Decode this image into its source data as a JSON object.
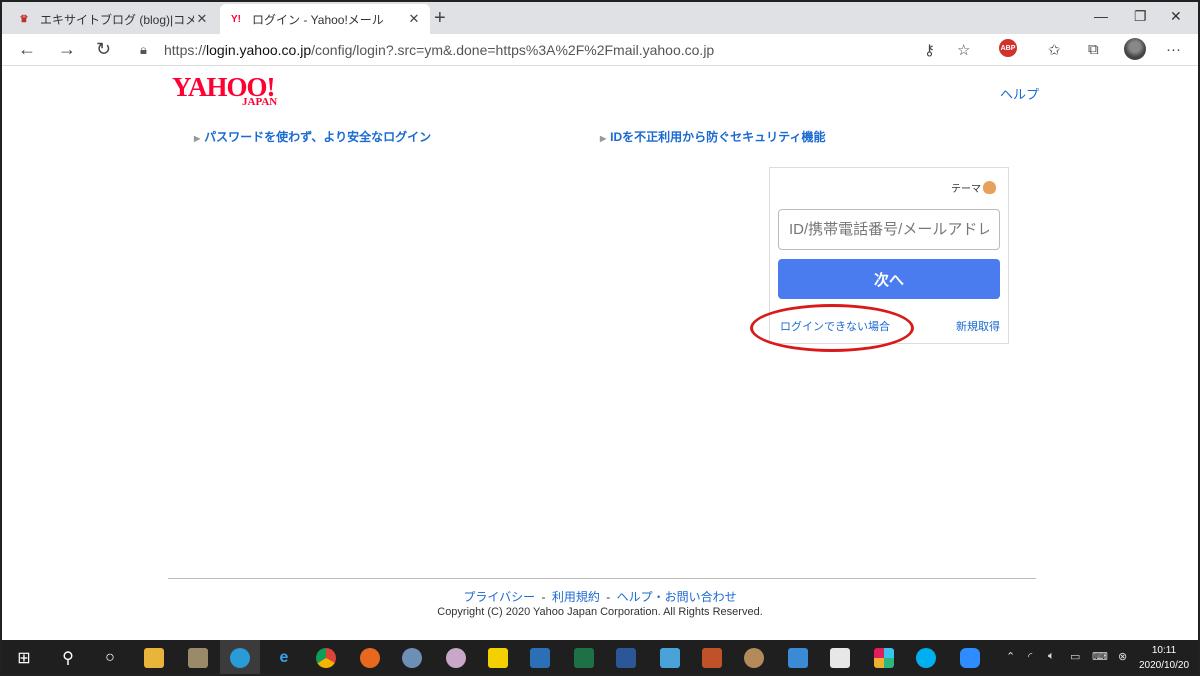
{
  "browser": {
    "tabs": [
      {
        "title": "エキサイトブログ (blog)|コメント・トラ",
        "favicon": "excite-icon"
      },
      {
        "title": "ログイン - Yahoo!メール",
        "favicon": "yahoo-icon",
        "favicon_text": "Y!"
      }
    ],
    "new_tab": "+",
    "url": {
      "prefix": "https://",
      "host": "login.yahoo.co.jp",
      "path": "/config/login?.src=ym&.done=https%3A%2F%2Fmail.yahoo.co.jp"
    },
    "extension_badge": "ABP",
    "icons": [
      "back-icon",
      "forward-icon",
      "refresh-icon",
      "lock-icon",
      "key-icon",
      "star-icon",
      "favorites-icon",
      "collections-icon",
      "menu-icon"
    ]
  },
  "page": {
    "logo": {
      "main": "YAHOO!",
      "sub": "JAPAN"
    },
    "help": "ヘルプ",
    "promos": [
      "パスワードを使わず、より安全なログイン",
      "IDを不正利用から防ぐセキュリティ機能"
    ],
    "login": {
      "theme": "テーマ",
      "id_placeholder": "ID/携帯電話番号/メールアドレス",
      "next_button": "次へ",
      "trouble_link": "ログインできない場合",
      "signup_link": "新規取得"
    },
    "footer": {
      "links": [
        "プライバシー",
        "利用規約",
        "ヘルプ・お問い合わせ"
      ],
      "separator": "-",
      "copyright": "Copyright (C) 2020 Yahoo Japan Corporation. All Rights Reserved."
    }
  },
  "annotation": {
    "color": "#d91a1a"
  },
  "taskbar": {
    "apps": [
      "start-icon",
      "search-icon",
      "cortana-icon",
      "file-explorer-icon",
      "photos-icon",
      "edge-icon",
      "ie-icon",
      "chrome-icon",
      "firefox-icon",
      "safari-icon",
      "paint-icon",
      "sticky-notes-icon",
      "tool-icon",
      "excel-icon",
      "word-icon",
      "app-icon",
      "toolbox-icon",
      "paint3d-icon",
      "remote-desktop-icon",
      "whiteboard-icon",
      "slack-icon",
      "skype-icon",
      "zoom-icon"
    ],
    "time": "10:11",
    "date": "2020/10/20"
  }
}
